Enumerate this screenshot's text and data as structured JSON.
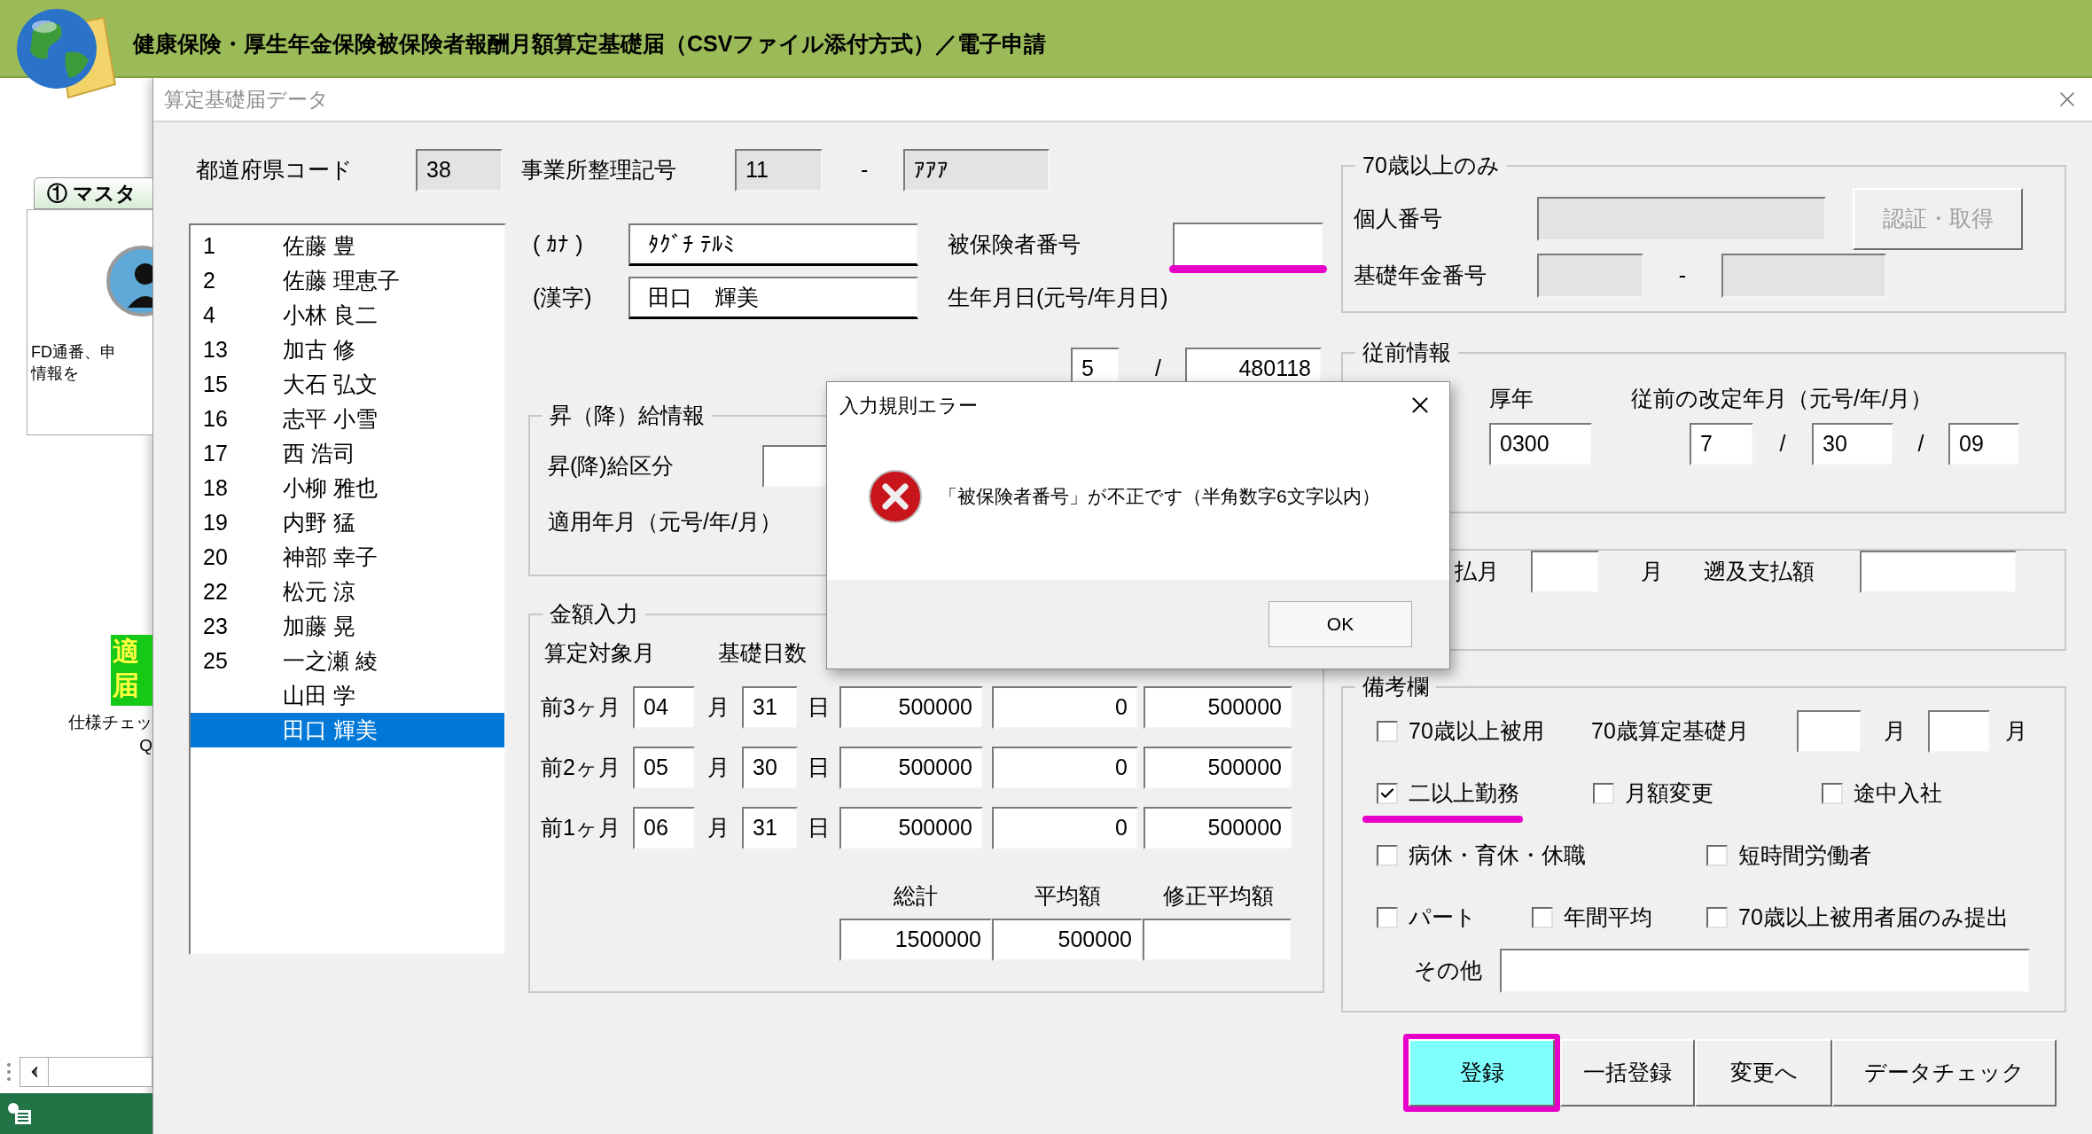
{
  "app": {
    "title": "健康保険・厚生年金保険被保険者報酬月額算定基礎届（CSVファイル添付方式）／電子申請",
    "tab": "① マスタ",
    "card_text": [
      "FD通番、申",
      "情報を"
    ],
    "tool_chars": [
      "適",
      "届"
    ],
    "tool_text": [
      "仕様チェッ",
      "Q"
    ]
  },
  "form": {
    "title": "算定基礎届データ",
    "prefecture": {
      "label": "都道府県コード",
      "value": "38"
    },
    "office": {
      "label": "事業所整理記号",
      "code": "11",
      "separator": "-",
      "symbol": "ｱｱｱ"
    },
    "employees": [
      {
        "number": "1",
        "name": "佐藤 豊",
        "selected": false
      },
      {
        "number": "2",
        "name": "佐藤 理恵子",
        "selected": false
      },
      {
        "number": "4",
        "name": "小林 良二",
        "selected": false
      },
      {
        "number": "13",
        "name": "加古 修",
        "selected": false
      },
      {
        "number": "15",
        "name": "大石 弘文",
        "selected": false
      },
      {
        "number": "16",
        "name": "志平 小雪",
        "selected": false
      },
      {
        "number": "17",
        "name": "西 浩司",
        "selected": false
      },
      {
        "number": "18",
        "name": "小柳 雅也",
        "selected": false
      },
      {
        "number": "19",
        "name": "内野 猛",
        "selected": false
      },
      {
        "number": "20",
        "name": "神部 幸子",
        "selected": false
      },
      {
        "number": "22",
        "name": "松元 涼",
        "selected": false
      },
      {
        "number": "23",
        "name": "加藤 晃",
        "selected": false
      },
      {
        "number": "25",
        "name": "一之瀬 綾",
        "selected": false
      },
      {
        "name": "山田 学",
        "selected": false
      },
      {
        "name": "田口 輝美",
        "selected": true
      }
    ],
    "kana": {
      "label": "( ｶﾅ )",
      "value": "ﾀｸﾞﾁ ﾃﾙﾐ"
    },
    "kanji": {
      "label": "(漢字)",
      "value": "田口　輝美"
    },
    "insured_number": {
      "label": "被保険者番号",
      "highlighted": true
    },
    "birth": {
      "label": "生年月日(元号/年月日)",
      "era": "5",
      "separator": "/",
      "date": "480118"
    },
    "raise": {
      "title": "昇（降）給情報",
      "type_label": "昇(降)給区分",
      "month_label": "適用年月（元号/年/月）"
    },
    "amounts": {
      "title": "金額入力",
      "headers": [
        "算定対象月",
        "基礎日数"
      ],
      "rows": [
        {
          "label": "前3ヶ月",
          "month": "04",
          "month_unit": "月",
          "days": "31",
          "day_unit": "日",
          "cash": "500000",
          "goods": "0",
          "total": "500000"
        },
        {
          "label": "前2ヶ月",
          "month": "05",
          "month_unit": "月",
          "days": "30",
          "day_unit": "日",
          "cash": "500000",
          "goods": "0",
          "total": "500000"
        },
        {
          "label": "前1ヶ月",
          "month": "06",
          "month_unit": "月",
          "days": "31",
          "day_unit": "日",
          "cash": "500000",
          "goods": "0",
          "total": "500000"
        }
      ],
      "summary_headers": [
        "総計",
        "平均額",
        "修正平均額"
      ],
      "sum": "1500000",
      "average": "500000"
    },
    "over70": {
      "title": "70歳以上のみ",
      "personal_label": "個人番号",
      "auth_button": {
        "label": "認証・取得",
        "disabled": true
      },
      "pension_label": "基礎年金番号",
      "separator": "-"
    },
    "previous": {
      "title": "従前情報",
      "pension_label": "厚年",
      "pension_value": "0300",
      "revision_label": "従前の改定年月（元号/年/月）",
      "revision": [
        "7",
        "30",
        "09"
      ],
      "separator": "/"
    },
    "retro": {
      "month_label": "払月",
      "unit": "月",
      "amount_label": "遡及支払額"
    },
    "remarks": {
      "title": "備考欄",
      "base_month_label": "70歳算定基礎月",
      "units": [
        "月",
        "月"
      ],
      "other_label": "その他",
      "rows": [
        [
          {
            "label": "70歳以上被用",
            "checked": false,
            "highlighted": false
          }
        ],
        [
          {
            "label": "二以上勤務",
            "checked": true,
            "highlighted": true
          },
          {
            "label": "月額変更",
            "checked": false,
            "highlighted": false
          },
          {
            "label": "途中入社",
            "checked": false,
            "highlighted": false
          }
        ],
        [
          {
            "label": "病休・育休・休職",
            "checked": false,
            "highlighted": false
          },
          {
            "label": "短時間労働者",
            "checked": false,
            "highlighted": false
          }
        ],
        [
          {
            "label": "パート",
            "checked": false,
            "highlighted": false
          },
          {
            "label": "年間平均",
            "checked": false,
            "highlighted": false
          },
          {
            "label": "70歳以上被用者届のみ提出",
            "checked": false,
            "highlighted": false
          }
        ]
      ]
    },
    "buttons": [
      {
        "label": "登録",
        "active": true,
        "highlighted": true
      },
      {
        "label": "一括登録",
        "active": false,
        "highlighted": false
      },
      {
        "label": "変更へ",
        "active": false,
        "highlighted": false
      },
      {
        "label": "データチェック",
        "active": false,
        "highlighted": false
      }
    ]
  },
  "dialog": {
    "title": "入力規則エラー",
    "message": "「被保険者番号」が不正です（半角数字6文字以内）",
    "button": "OK"
  }
}
